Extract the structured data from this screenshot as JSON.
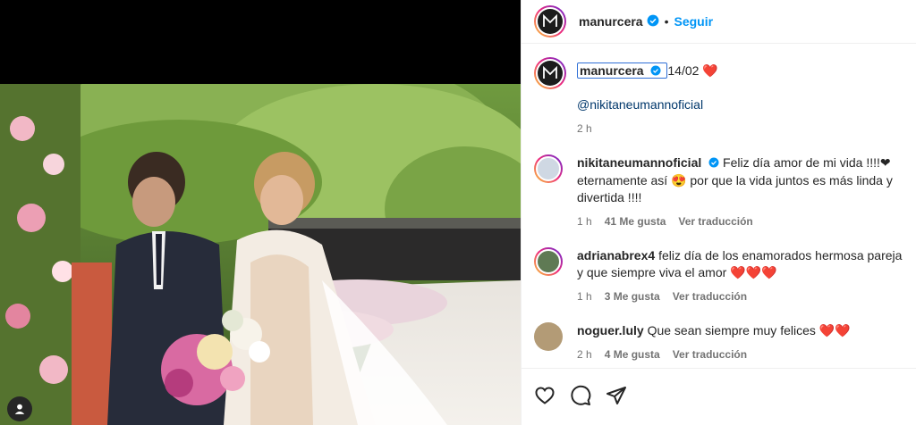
{
  "post": {
    "username": "manurcera",
    "follow_label": "Seguir",
    "separator": "•"
  },
  "caption": {
    "username": "manurcera",
    "text": "14/02",
    "emoji": "❤️",
    "mention": "@nikitaneumannoficial",
    "time": "2 h"
  },
  "comments": [
    {
      "username": "nikitaneumannoficial",
      "verified": true,
      "text": "Feliz día amor de mi vida !!!!❤ eternamente así 😍 por que la vida juntos es más linda y divertida !!!!",
      "time": "1 h",
      "likes": "41 Me gusta",
      "translate": "Ver traducción"
    },
    {
      "username": "adrianabrex4",
      "verified": false,
      "text": "feliz día de los enamorados hermosa pareja y que siempre viva el amor ❤️❤️❤️",
      "time": "1 h",
      "likes": "3 Me gusta",
      "translate": "Ver traducción"
    },
    {
      "username": "noguer.luly",
      "verified": false,
      "text": "Que sean siempre muy felices ❤️❤️",
      "time": "2 h",
      "likes": "4 Me gusta",
      "translate": "Ver traducción"
    }
  ],
  "colors": {
    "accent": "#0095f6",
    "verified": "#0095f6",
    "heart": "#e0245e"
  },
  "icons": {
    "like": "heart-outline-icon",
    "comment": "speech-bubble-icon",
    "share": "paper-plane-icon",
    "tag": "user-tag-icon"
  }
}
